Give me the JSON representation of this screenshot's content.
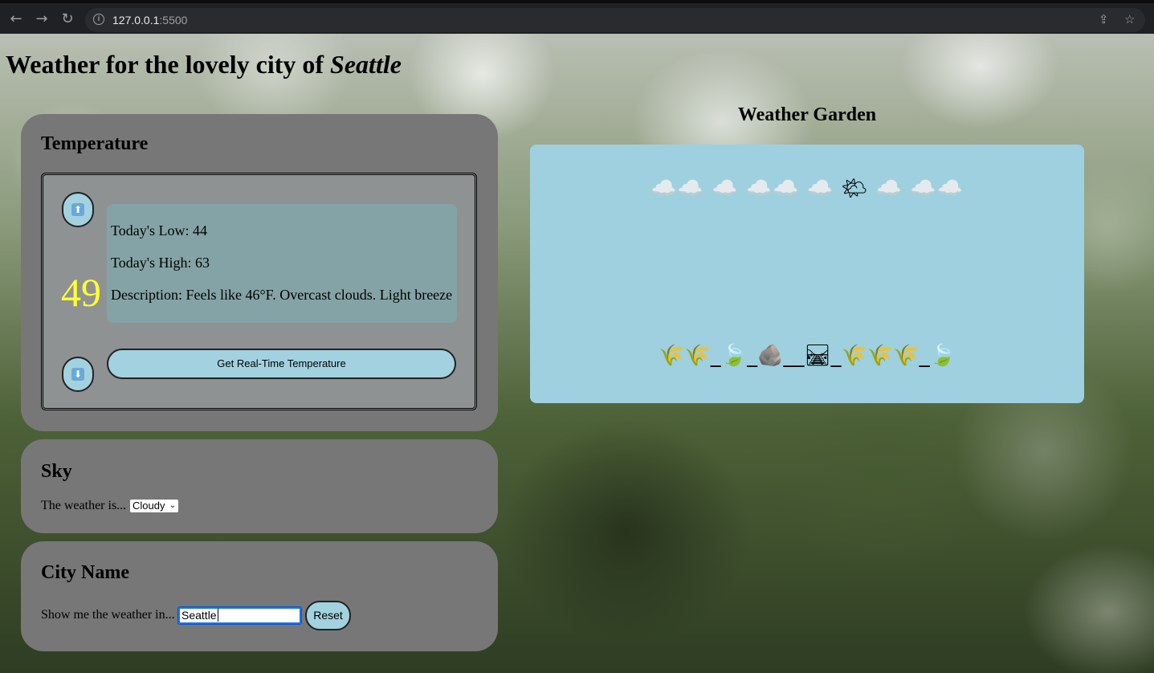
{
  "browser": {
    "url_host": "127.0.0.1",
    "url_port": ":5500"
  },
  "page": {
    "title_prefix": "Weather for the lovely city of ",
    "title_city": "Seattle"
  },
  "temperature": {
    "heading": "Temperature",
    "current": "49",
    "current_color": "#ffff33",
    "low_text": "Today's Low: 44",
    "high_text": "Today's High: 63",
    "description_text": "Description: Feels like 46°F. Overcast clouds. Light breeze",
    "realtime_button": "Get Real-Time Temperature",
    "up_icon": "arrow-up-icon",
    "down_icon": "arrow-down-icon"
  },
  "sky": {
    "heading": "Sky",
    "label": "The weather is...",
    "selected": "Cloudy"
  },
  "city": {
    "heading": "City Name",
    "label": "Show me the weather in...",
    "input_value": "Seattle",
    "reset_button": "Reset"
  },
  "garden": {
    "heading": "Weather Garden",
    "sky_emojis": "☁️☁️ ☁️ ☁️☁️ ☁️ 🌤 ☁️ ☁️☁️",
    "ground_emojis": "🌾🌾_🍃_🪨__🛤_🌾🌾🌾_🍃",
    "background_color": "#9fd0df"
  },
  "colors": {
    "panel": "#777777",
    "button": "#a2d2df"
  }
}
